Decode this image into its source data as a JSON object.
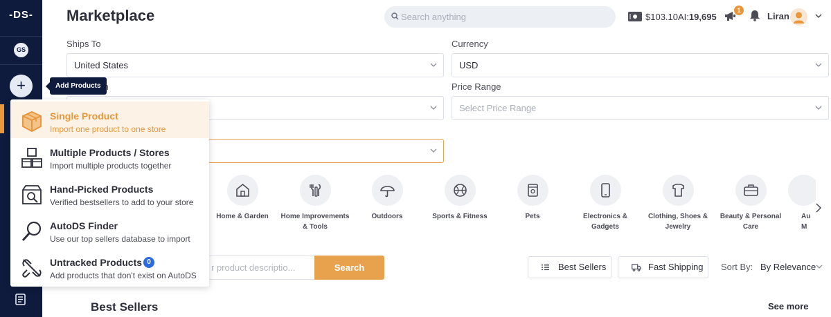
{
  "app": {
    "logo": "-DS-",
    "workspace_initials": "GS",
    "add_tooltip": "Add Products"
  },
  "header": {
    "title": "Marketplace",
    "search_placeholder": "Search anything",
    "balance": "$103.10",
    "ai_label": "AI:",
    "ai_credits": "19,695",
    "notification_count": "1",
    "username": "Liran"
  },
  "filters": {
    "ships_to_label": "Ships To",
    "ships_to_value": "United States",
    "currency_label": "Currency",
    "currency_value": "USD",
    "ships_from_label_visible": "m",
    "price_range_label": "Price Range",
    "price_range_placeholder": "Select Price Range"
  },
  "categories": [
    {
      "label": "Home & Garden",
      "icon": "house-icon"
    },
    {
      "label": "Home Improvements & Tools",
      "icon": "tools-icon"
    },
    {
      "label": "Outdoors",
      "icon": "umbrella-icon"
    },
    {
      "label": "Sports & Fitness",
      "icon": "ball-icon"
    },
    {
      "label": "Pets",
      "icon": "pet-food-icon"
    },
    {
      "label": "Electronics & Gadgets",
      "icon": "phone-icon"
    },
    {
      "label": "Clothing, Shoes & Jewelry",
      "icon": "shirt-icon"
    },
    {
      "label": "Beauty & Personal Care",
      "icon": "beauty-case-icon"
    },
    {
      "label": "Au M",
      "icon": "car-icon"
    }
  ],
  "search_row": {
    "placeholder": "r product descriptio...",
    "search_button": "Search",
    "best_sellers_button": "Best Sellers",
    "fast_shipping_button": "Fast Shipping",
    "sort_label": "Sort By:",
    "sort_value": "By Relevance"
  },
  "section": {
    "title": "Best Sellers",
    "see_more": "See more"
  },
  "add_menu": [
    {
      "title": "Single Product",
      "subtitle": "Import one product to one store",
      "icon": "box-icon",
      "active": true
    },
    {
      "title": "Multiple Products / Stores",
      "subtitle": "Import multiple products together",
      "icon": "boxes-icon",
      "active": false
    },
    {
      "title": "Hand-Picked Products",
      "subtitle": "Verified bestsellers to add to your store",
      "icon": "store-search-icon",
      "active": false
    },
    {
      "title": "AutoDS Finder",
      "subtitle": "Use our top sellers database to import",
      "icon": "magnifier-icon",
      "active": false
    },
    {
      "title": "Untracked Products",
      "subtitle": "Add products that don't exist on AutoDS",
      "icon": "unlink-icon",
      "active": false,
      "badge": "0"
    }
  ],
  "colors": {
    "rail": "#0f1b3d",
    "accent": "#e8973c",
    "badge_blue": "#2d6cdf"
  }
}
